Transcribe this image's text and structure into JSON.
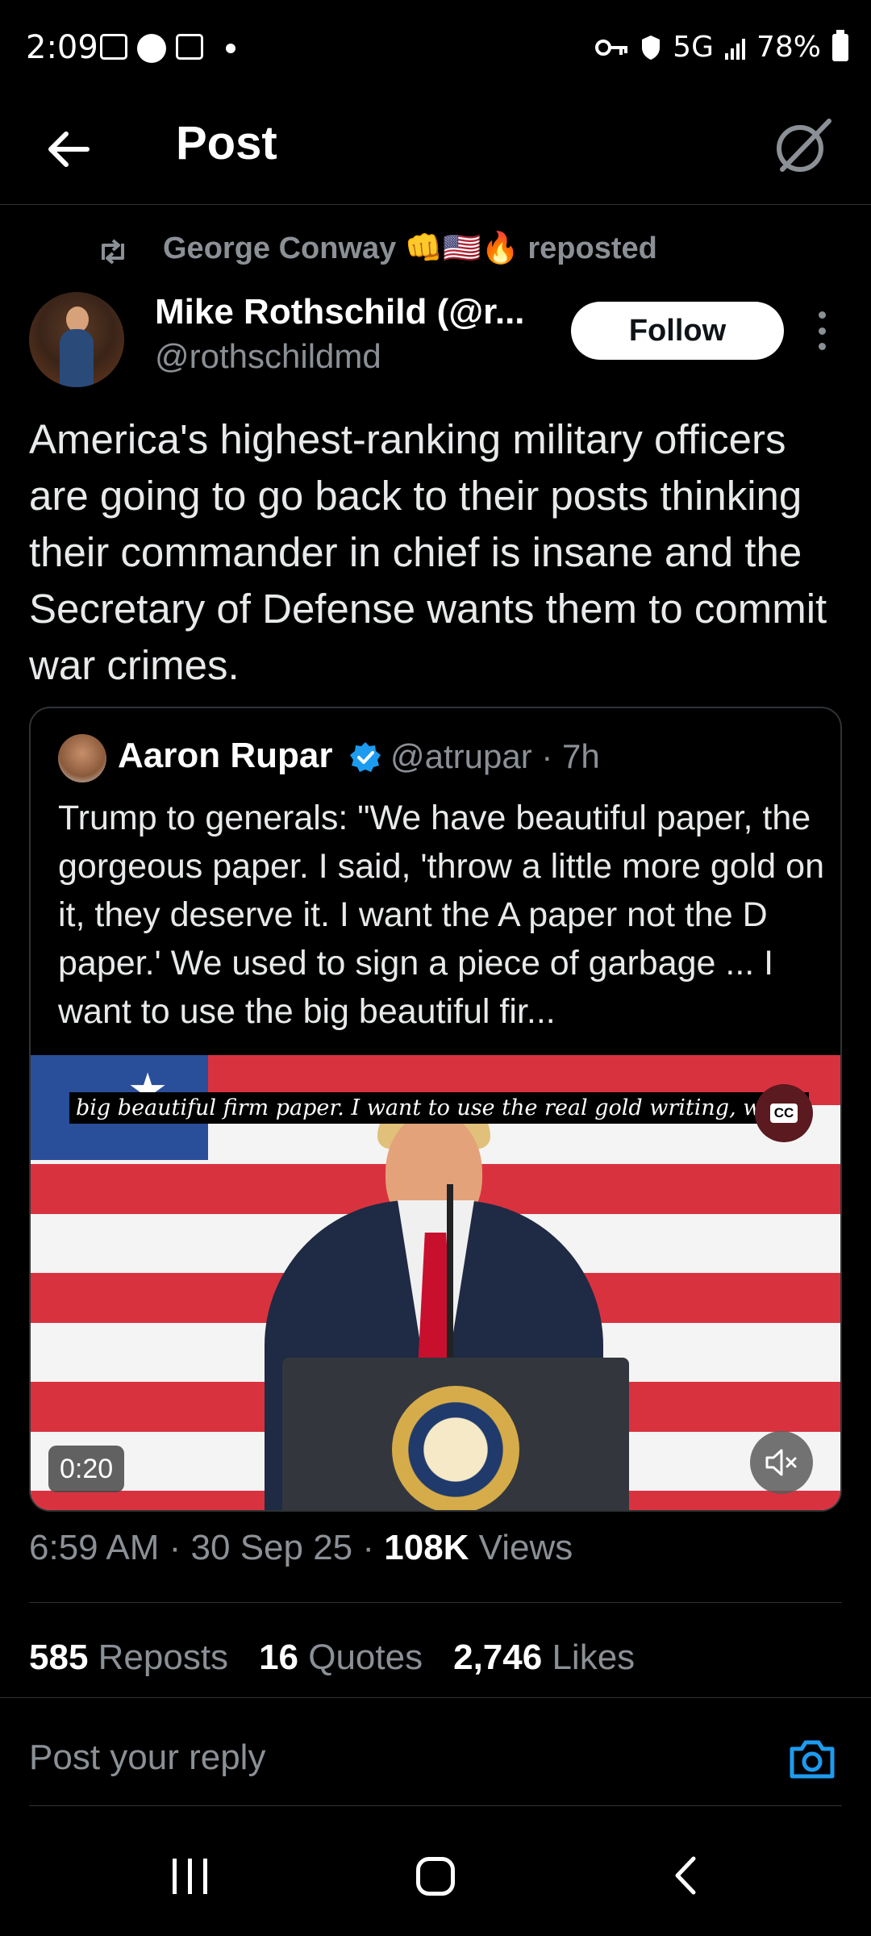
{
  "status_bar": {
    "time": "2:09",
    "network": "5G",
    "battery": "78%"
  },
  "header": {
    "title": "Post"
  },
  "repost": {
    "by": "George Conway 👊🇺🇸🔥",
    "suffix": "reposted"
  },
  "author": {
    "name": "Mike Rothschild (@r...",
    "handle": "@rothschildmd",
    "follow_label": "Follow"
  },
  "post": {
    "text": "America's highest-ranking military officers are going to go back to their posts thinking their commander in chief is insane and the Secretary of Defense wants them to commit war crimes."
  },
  "quote": {
    "name": "Aaron Rupar",
    "handle_time": "@atrupar · 7h",
    "text": "Trump to generals: \"We have beautiful paper, the gorgeous paper. I said, 'throw a little more gold on it, they deserve it. I want the A paper not the D paper.' We used to sign a piece of garbage ... I want to use the big beautiful fir...",
    "video": {
      "caption": "big beautiful firm paper. I want to use the real gold writing, when",
      "cc_label": "CC",
      "duration": "0:20"
    }
  },
  "meta": {
    "time_date": "6:59 AM · 30 Sep 25 · ",
    "views_count": "108K",
    "views_label": " Views"
  },
  "stats": {
    "reposts_count": "585",
    "reposts_label": " Reposts",
    "quotes_count": "16",
    "quotes_label": " Quotes",
    "likes_count": "2,746",
    "likes_label": " Likes"
  },
  "reply": {
    "placeholder": "Post your reply"
  },
  "colors": {
    "background": "#000000",
    "accent": "#1d9bf0",
    "secondary_text": "#8b9096"
  }
}
